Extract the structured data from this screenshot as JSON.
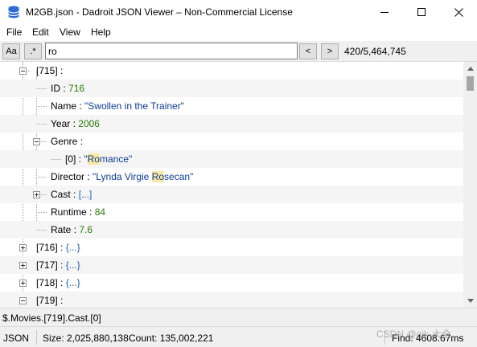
{
  "window": {
    "title": "M2GB.json - Dadroit JSON Viewer – Non-Commercial License"
  },
  "menu": {
    "file": "File",
    "edit": "Edit",
    "view": "View",
    "help": "Help"
  },
  "toolbar": {
    "match_case": "Aa",
    "regex": ".*",
    "search_value": "ro",
    "prev": "<",
    "next": ">",
    "match_count": "420/5,464,745"
  },
  "tree": {
    "n715": {
      "key": "[715]",
      "sep": " :"
    },
    "id": {
      "key": "ID",
      "sep": " : ",
      "value": "716"
    },
    "name": {
      "key": "Name",
      "sep": " : ",
      "value": "\"Swollen in the Trainer\""
    },
    "year": {
      "key": "Year",
      "sep": " : ",
      "value": "2006"
    },
    "genre": {
      "key": "Genre",
      "sep": " :"
    },
    "genre0": {
      "key": "[0]",
      "sep": " : ",
      "pre": "\"",
      "hl": "Ro",
      "post": "mance\""
    },
    "director": {
      "key": "Director",
      "sep": " : ",
      "pre": "\"Lynda Virgie ",
      "hl": "Ro",
      "post": "secan\""
    },
    "cast": {
      "key": "Cast",
      "sep": " : ",
      "value": "[...]"
    },
    "runtime": {
      "key": "Runtime",
      "sep": " : ",
      "value": "84"
    },
    "rate": {
      "key": "Rate",
      "sep": " : ",
      "value": "7.6"
    },
    "n716": {
      "key": "[716]",
      "sep": " : ",
      "value": "{...}"
    },
    "n717": {
      "key": "[717]",
      "sep": " : ",
      "value": "{...}"
    },
    "n718": {
      "key": "[718]",
      "sep": " : ",
      "value": "{...}"
    },
    "n719": {
      "key": "[719]",
      "sep": " :"
    }
  },
  "path": "$.Movies.[719].Cast.[0]",
  "status": {
    "type": "JSON",
    "size": "Size: 2,025,880,138",
    "count": "Count: 135,002,221",
    "find": "Find: 4608.67ms"
  },
  "watermark": "CSDN @gjk·大全",
  "colors": {
    "string": "#0b3d91",
    "number": "#2b7a0b",
    "highlight": "#fbe9a6"
  }
}
